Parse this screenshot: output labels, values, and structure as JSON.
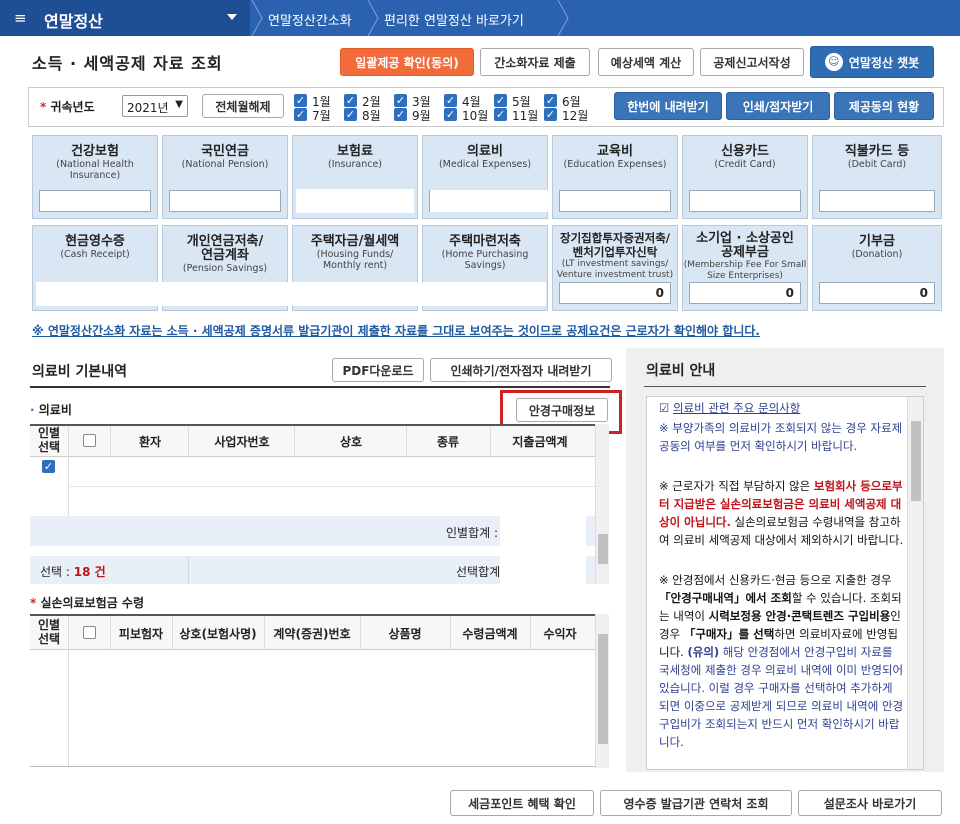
{
  "nav": {
    "menu_title": "연말정산",
    "breadcrumbs": [
      "연말정산간소화",
      "편리한 연말정산 바로가기"
    ]
  },
  "page": {
    "title": "소득 · 세액공제 자료 조회",
    "buttons": {
      "consent": "일괄제공 확인(동의)",
      "submit": "간소화자료 제출",
      "estimate": "예상세액 계산",
      "report": "공제신고서작성",
      "chatbot": "연말정산 챗봇"
    }
  },
  "year_row": {
    "label": "귀속년도",
    "year_value": "2021년",
    "toggle_all": "전체월해제",
    "months": [
      "1월",
      "2월",
      "3월",
      "4월",
      "5월",
      "6월",
      "7월",
      "8월",
      "9월",
      "10월",
      "11월",
      "12월"
    ],
    "download_all": "한번에 내려받기",
    "print_braille": "인쇄/점자받기",
    "deduction_status": "제공동의 현황"
  },
  "cards": [
    {
      "ko": "건강보험",
      "en": "(National Health Insurance)",
      "value": ""
    },
    {
      "ko": "국민연금",
      "en": "(National Pension)",
      "value": ""
    },
    {
      "ko": "보험료",
      "en": "(Insurance)",
      "value": ""
    },
    {
      "ko": "의료비",
      "en": "(Medical Expenses)",
      "value": ""
    },
    {
      "ko": "교육비",
      "en": "(Education Expenses)",
      "value": ""
    },
    {
      "ko": "신용카드",
      "en": "(Credit Card)",
      "value": ""
    },
    {
      "ko": "직불카드 등",
      "en": "(Debit Card)",
      "value": ""
    },
    {
      "ko": "현금영수증",
      "en": "(Cash Receipt)",
      "value": ""
    },
    {
      "ko": "개인연금저축/ 연금계좌",
      "en": "(Pension Savings)",
      "value": ""
    },
    {
      "ko": "주택자금/월세액",
      "en": "(Housing Funds/ Monthly rent)",
      "value": ""
    },
    {
      "ko": "주택마련저축",
      "en": "(Home Purchasing Savings)",
      "value": ""
    },
    {
      "ko": "장기집합투자증권저축/ 벤처기업투자신탁",
      "en": "(LT investment savings/ Venture investment trust)",
      "value": "0"
    },
    {
      "ko": "소기업 · 소상공인 공제부금",
      "en": "(Membership Fee For Small Size Enterprises)",
      "value": "0"
    },
    {
      "ko": "기부금",
      "en": "(Donation)",
      "value": "0"
    }
  ],
  "notice": "※ 연말정산간소화 자료는 소득 · 세액공제 증명서류 발급기관이 제출한 자료를 그대로 보여주는 것이므로 공제요건은 근로자가 확인해야 합니다.",
  "medical": {
    "section_title": "의료비 기본내역",
    "pdf_button": "PDF다운로드",
    "print_button": "인쇄하기/전자점자 내려받기",
    "sub_title": "의료비",
    "glasses_button": "안경구매정보",
    "columns": [
      "인별 선택",
      "환자",
      "사업자번호",
      "상호",
      "종류",
      "지출금액계"
    ],
    "subtotal_label": "인별합계 :",
    "selected_label": "선택 :",
    "selected_count": "18 건",
    "selected_total_label": "선택합계"
  },
  "insurance": {
    "sub_title": "실손의료보험금 수령",
    "columns": [
      "인별 선택",
      "피보험자",
      "상호(보험사명)",
      "계약(증권)번호",
      "상품명",
      "수령금액계",
      "수익자"
    ]
  },
  "guide": {
    "title": "의료비 안내",
    "link": "의료비 관련 주요 문의사항",
    "p1": "※ 부양가족의 의료비가 조회되지 않는 경우 자료제공동의 여부를 먼저 확인하시기 바랍니다.",
    "p2_a": "※ 근로자가 직접 부담하지 않은 ",
    "p2_b": "보험회사 등으로부터 지급받은 실손의료보험금은 의료비 세액공제 대상이 아닙니다.",
    "p2_c": " 실손의료보험금 수령내역을 참고하여 의료비 세액공제 대상에서 제외하시기 바랍니다.",
    "p3_a": "※ 안경점에서 신용카드·현금 등으로 지출한 경우 ",
    "p3_b": "「안경구매내역」에서 조회",
    "p3_c": "할 수 있습니다. 조회되는 내역이 ",
    "p3_d": "시력보정용 안경·콘택트렌즈 구입비용",
    "p3_e": "인 경우 ",
    "p3_f": "「구매자」를 선택",
    "p3_g": "하면 의료비자료에 반영됩니다. ",
    "p3_h": "(유의)",
    "p3_i": " 해당 안경점에서 안경구입비 자료를 국세청에 제출한 경우 의료비 내역에 이미 반영되어 있습니다. 이럴 경우 구매자를 선택하여 추가하게 되면 이중으로 공제받게 되므로 의료비 내역에 안경구입비가 조회되는지 반드시 먼저 확인하시기 바랍니다."
  },
  "footer": {
    "tax_point": "세금포인트 혜택 확인",
    "receipt_contact": "영수증 발급기관 연락처 조회",
    "survey": "설문조사 바로가기"
  }
}
